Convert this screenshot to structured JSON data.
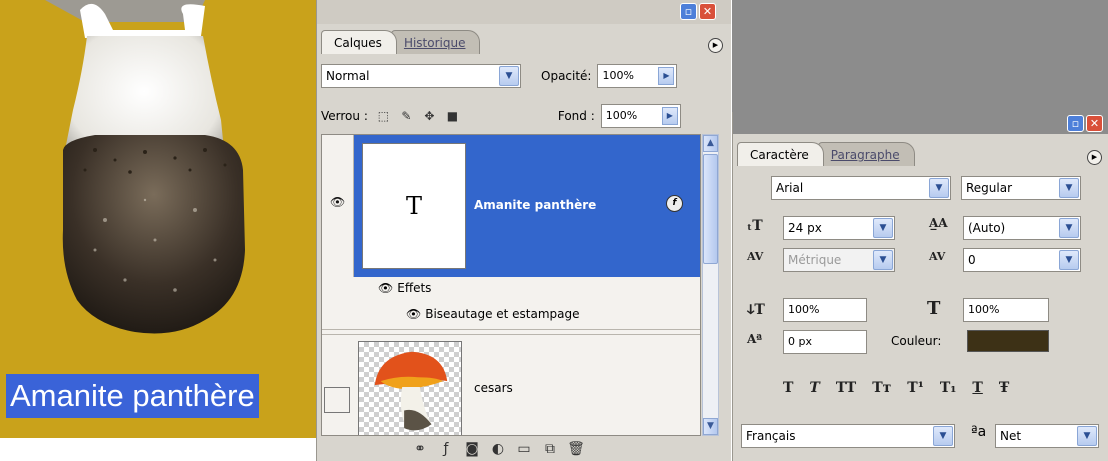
{
  "canvas": {
    "text_layer_label": "Amanite panthère",
    "background_color": "#c9a21b"
  },
  "layers_panel": {
    "tabs": [
      "Calques",
      "Historique"
    ],
    "blend_mode": "Normal",
    "opacity_label": "Opacité:",
    "opacity_value": "100%",
    "lock_label": "Verrou :",
    "fill_label": "Fond :",
    "fill_value": "100%",
    "layers": [
      {
        "name": "Amanite panthère",
        "thumb_glyph": "T",
        "selected": true
      },
      {
        "name": "cesars",
        "selected": false
      }
    ],
    "effects_label": "Effets",
    "effect_item": "Biseautage et estampage",
    "selection_color": "#3366cc"
  },
  "character_panel": {
    "tabs": [
      "Caractère",
      "Paragraphe"
    ],
    "font_family": "Arial",
    "font_style": "Regular",
    "font_size": "24 px",
    "leading": "(Auto)",
    "kerning": "Métrique",
    "tracking": "0",
    "vertical_scale": "100%",
    "horizontal_scale": "100%",
    "baseline_shift": "0 px",
    "color_label": "Couleur:",
    "text_color": "#3d3116",
    "style_buttons": [
      "T",
      "T",
      "TT",
      "Tт",
      "T¹",
      "T₁",
      "T",
      "Ŧ"
    ],
    "language": "Français",
    "antialias_icon": "ªa",
    "antialias": "Net"
  }
}
